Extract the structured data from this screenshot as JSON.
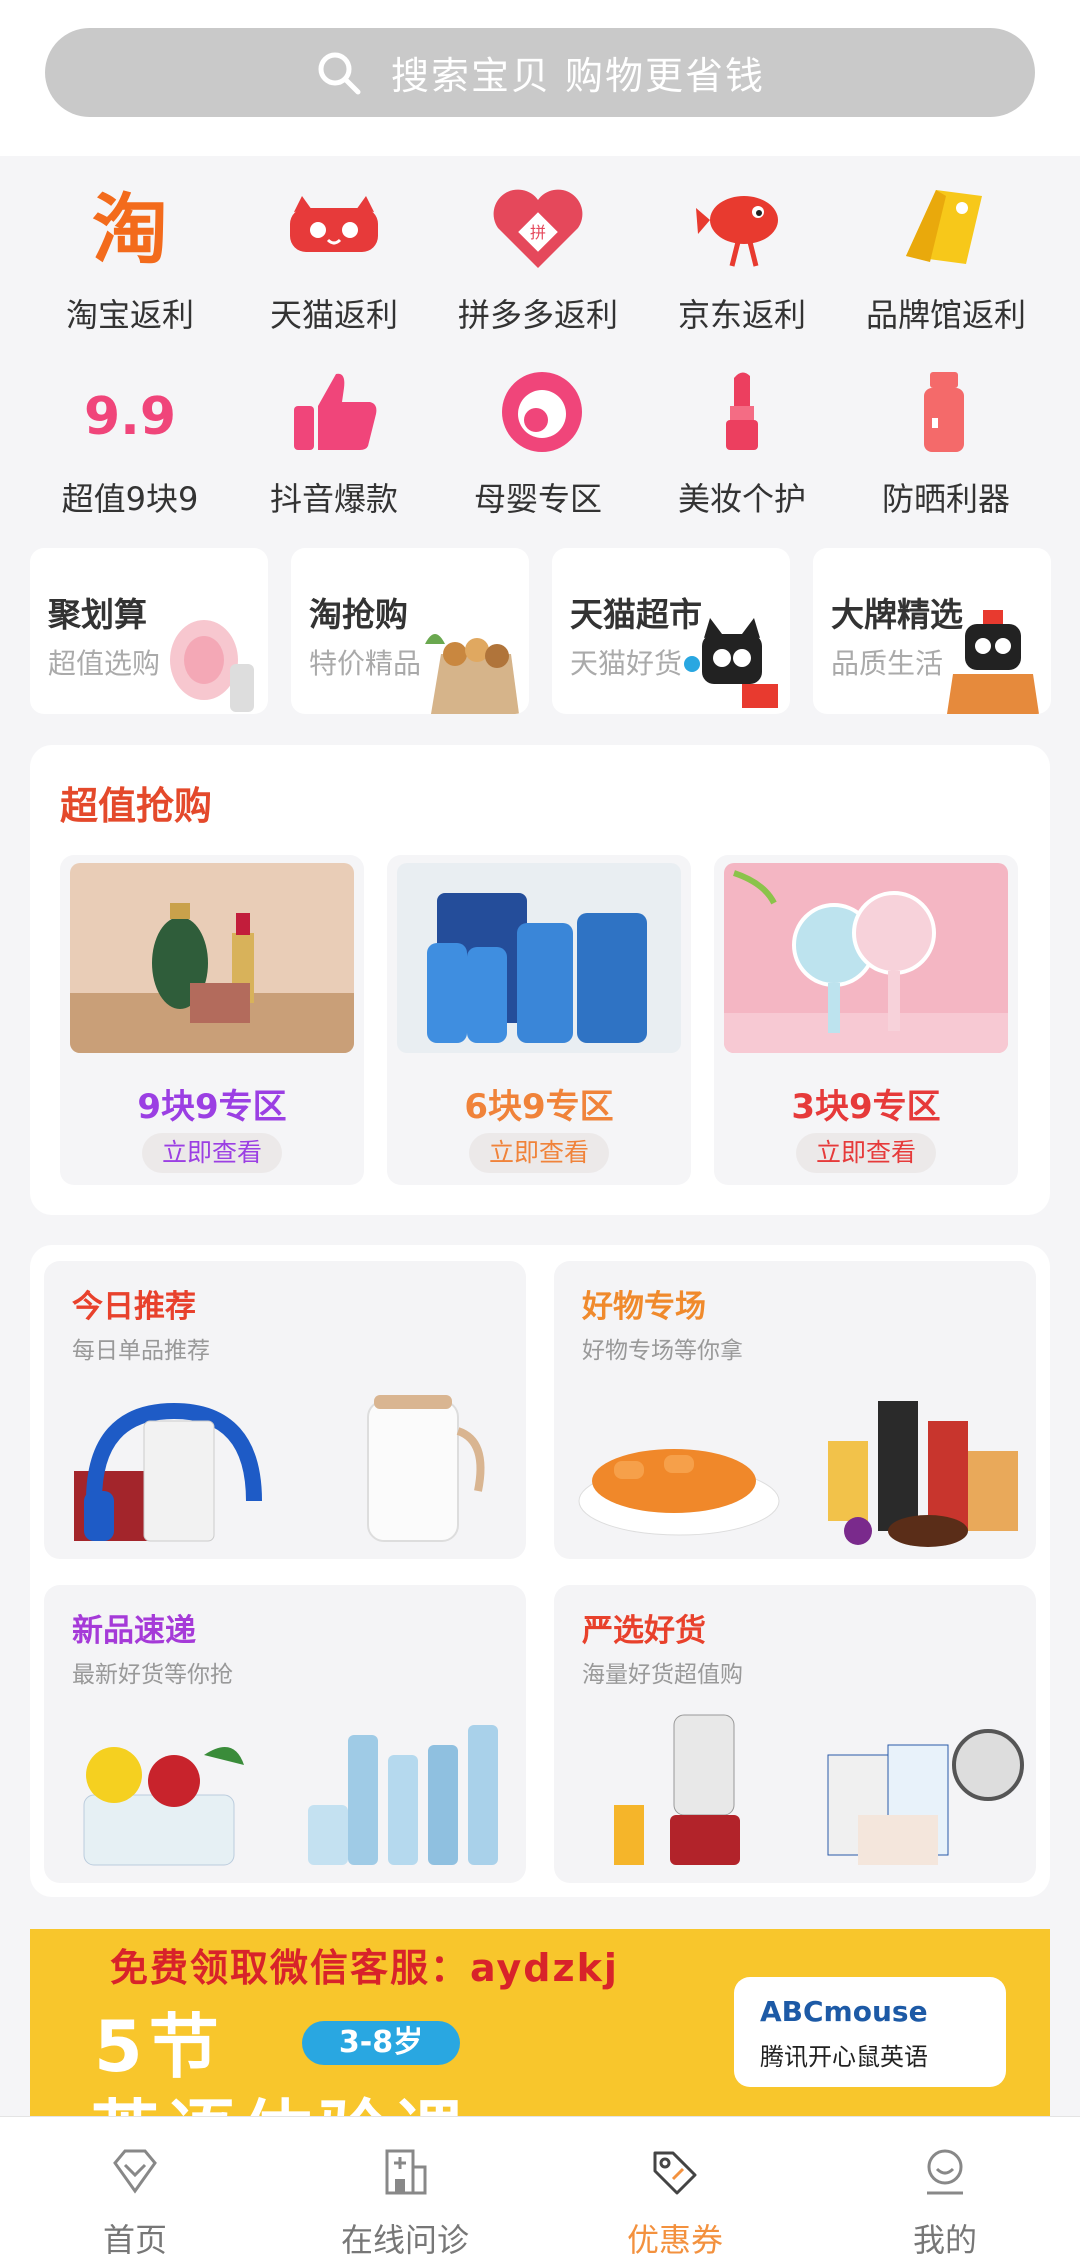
{
  "search": {
    "placeholder": "搜索宝贝  购物更省钱"
  },
  "categories": [
    {
      "label": "淘宝返利",
      "icon": "taobao-icon"
    },
    {
      "label": "天猫返利",
      "icon": "tmall-icon"
    },
    {
      "label": "拼多多返利",
      "icon": "pinduoduo-icon"
    },
    {
      "label": "京东返利",
      "icon": "jd-icon"
    },
    {
      "label": "品牌馆返利",
      "icon": "tag-icon"
    },
    {
      "label": "超值9块9",
      "icon": "nine-nine-icon"
    },
    {
      "label": "抖音爆款",
      "icon": "thumbs-up-icon"
    },
    {
      "label": "母婴专区",
      "icon": "mother-baby-icon"
    },
    {
      "label": "美妆个护",
      "icon": "lipstick-icon"
    },
    {
      "label": "防晒利器",
      "icon": "sunscreen-icon"
    }
  ],
  "channels": [
    {
      "title": "聚划算",
      "subtitle": "超值选购"
    },
    {
      "title": "淘抢购",
      "subtitle": "特价精品"
    },
    {
      "title": "天猫超市",
      "subtitle": "天猫好货"
    },
    {
      "title": "大牌精选",
      "subtitle": "品质生活"
    }
  ],
  "grab": {
    "title": "超值抢购",
    "items": [
      {
        "name": "9块9专区",
        "button": "立即查看",
        "color": "#9b3fe3"
      },
      {
        "name": "6块9专区",
        "button": "立即查看",
        "color": "#f0833a"
      },
      {
        "name": "3块9专区",
        "button": "立即查看",
        "color": "#e63a3a"
      }
    ]
  },
  "recommend": [
    {
      "title": "今日推荐",
      "subtitle": "每日单品推荐",
      "color": "#e8412c"
    },
    {
      "title": "好物专场",
      "subtitle": "好物专场等你拿",
      "color": "#f08a2c"
    },
    {
      "title": "新品速递",
      "subtitle": "最新好货等你抢",
      "color": "#a53ad8"
    },
    {
      "title": "严选好货",
      "subtitle": "海量好货超值购",
      "color": "#e8412c"
    }
  ],
  "banner": {
    "line1": "免费领取微信客服：aydzkj",
    "line2": "5节",
    "age": "3-8岁",
    "line3": "英语体验课",
    "brand": "ABCmouse",
    "brand_cn": "腾讯开心鼠英语"
  },
  "tabs": [
    {
      "label": "首页",
      "icon": "home-diamond-icon"
    },
    {
      "label": "在线问诊",
      "icon": "hospital-icon"
    },
    {
      "label": "优惠券",
      "icon": "coupon-tag-icon"
    },
    {
      "label": "我的",
      "icon": "user-icon"
    }
  ],
  "colors": {
    "accent": "#f3913e",
    "grab_title": "#e4492b"
  }
}
